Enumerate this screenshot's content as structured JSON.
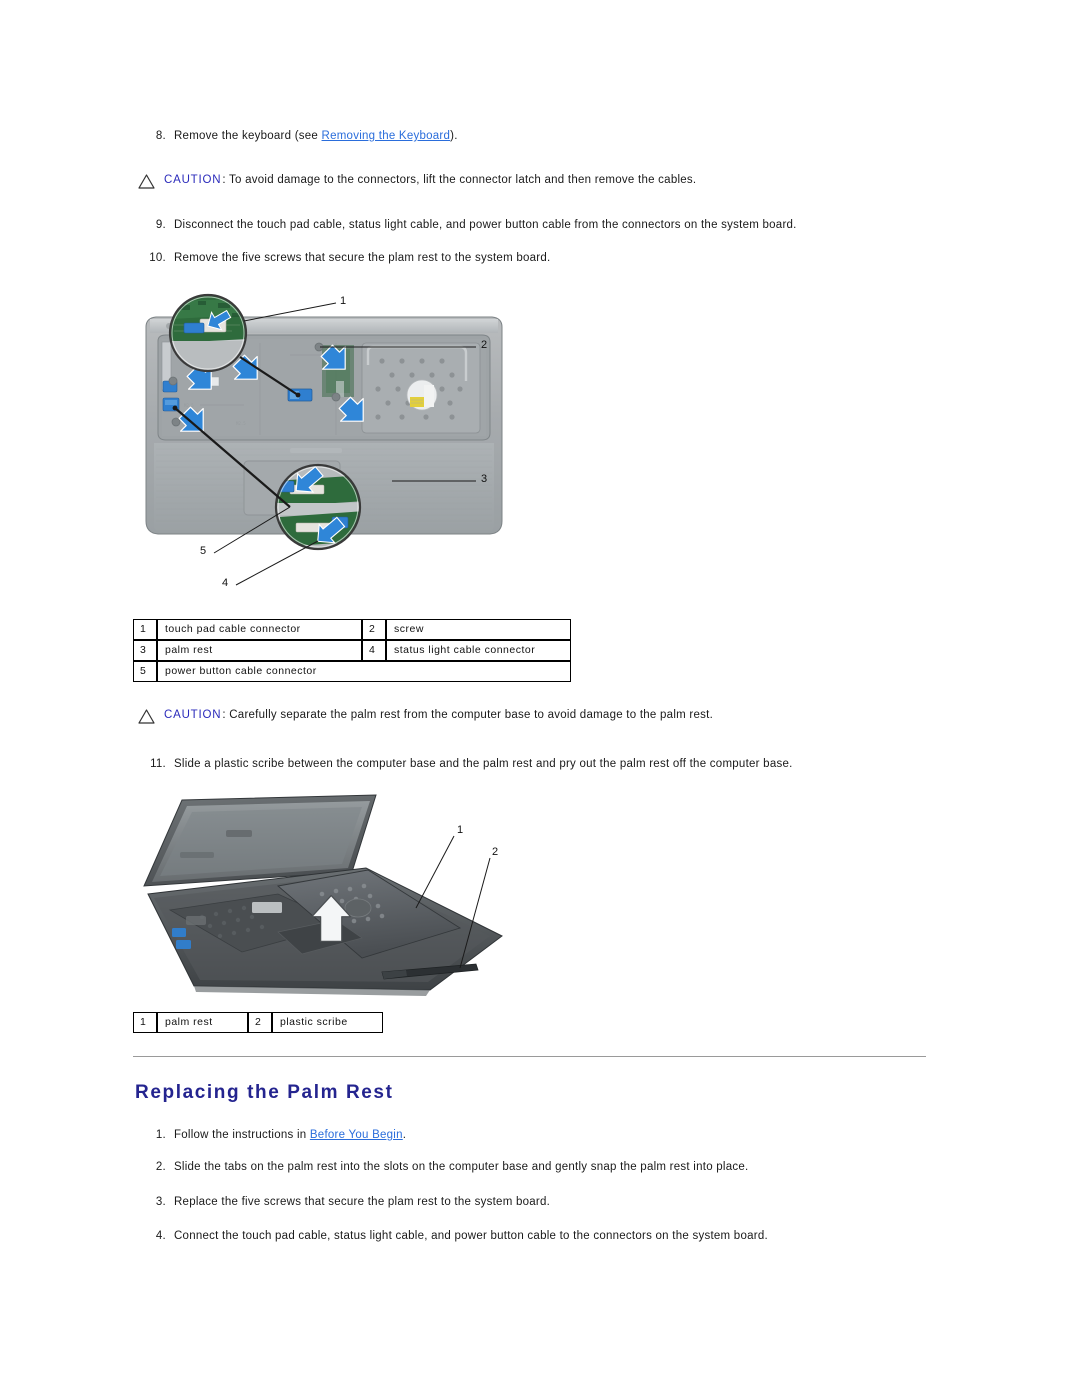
{
  "document": {
    "type": "service-manual-page",
    "link_color": "#2a6ddb",
    "heading_color": "#24248f",
    "caution_label_color": "#2b2bbb"
  },
  "steps_top": [
    {
      "number": "8.",
      "text_before": "Remove the keyboard (see ",
      "link": "Removing the Keyboard",
      "text_after": ")."
    },
    {
      "number": "9.",
      "text_before": "Disconnect the touch pad cable, status light cable, and power button cable from the connectors on the system board.",
      "link": "",
      "text_after": ""
    },
    {
      "number": "10.",
      "text_before": "Remove the five screws that secure the plam rest to the system board.",
      "link": "",
      "text_after": ""
    },
    {
      "number": "11.",
      "text_before": "Slide a plastic scribe between the computer base and the palm rest and pry out the palm rest off the computer base.",
      "link": "",
      "text_after": ""
    }
  ],
  "cautions": [
    {
      "label": "CAUTION",
      "separator": ": ",
      "text": "To avoid damage to the connectors, lift the connector latch and then remove the cables."
    },
    {
      "label": "CAUTION",
      "separator": ": ",
      "text": "Carefully separate the palm rest from the computer base to avoid damage to the palm rest."
    }
  ],
  "figure1": {
    "name": "palm-rest-screws-and-connectors",
    "callouts": [
      "1",
      "2",
      "3",
      "4",
      "5"
    ],
    "table": [
      {
        "index": "1",
        "label": "touch pad cable connector",
        "index2": "2",
        "label2": "screw"
      },
      {
        "index": "3",
        "label": "palm rest",
        "index2": "4",
        "label2": "status light cable connector"
      },
      {
        "index": "5",
        "label": "power button cable connector",
        "index2": "",
        "label2": ""
      }
    ]
  },
  "figure2": {
    "name": "palm-rest-pry-off",
    "callouts": [
      "1",
      "2"
    ],
    "table": [
      {
        "index": "1",
        "label": "palm rest",
        "index2": "2",
        "label2": "plastic scribe"
      }
    ]
  },
  "section": {
    "title": "Replacing the Palm Rest",
    "steps": [
      {
        "number": "1.",
        "text_before": "Follow the instructions in ",
        "link": "Before You Begin",
        "text_after": "."
      },
      {
        "number": "2.",
        "text_before": "Slide the tabs on the palm rest into the slots on the computer base and gently snap the palm rest into place.",
        "link": "",
        "text_after": ""
      },
      {
        "number": "3.",
        "text_before": "Replace the five screws that secure the plam rest to the system board.",
        "link": "",
        "text_after": ""
      },
      {
        "number": "4.",
        "text_before": "Connect the touch pad cable, status light cable, and power button cable to the connectors on the system board.",
        "link": "",
        "text_after": ""
      }
    ]
  }
}
